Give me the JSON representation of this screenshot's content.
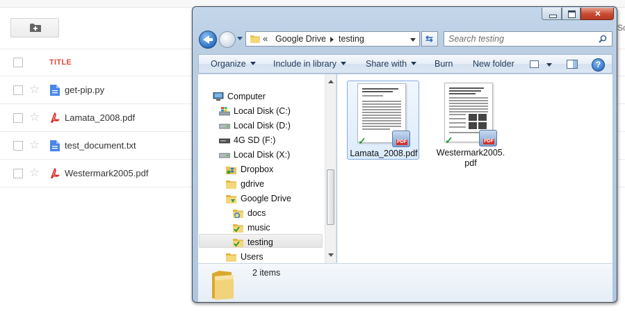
{
  "web": {
    "new_folder_label": "",
    "column_title": "TITLE",
    "files": [
      {
        "name": "get-pip.py",
        "icon": "document-icon",
        "color": "#4a86e8"
      },
      {
        "name": "Lamata_2008.pdf",
        "icon": "pdf-icon",
        "color": "#d93025"
      },
      {
        "name": "test_document.txt",
        "icon": "document-icon",
        "color": "#4a86e8"
      },
      {
        "name": "Westermark2005.pdf",
        "icon": "pdf-icon",
        "color": "#d93025"
      }
    ],
    "cut_text": "Sc"
  },
  "explorer": {
    "caption": {
      "minimize": "minimize",
      "maximize": "maximize",
      "close": "×"
    },
    "address": {
      "chevron": "«",
      "crumbs": [
        "Google Drive",
        "testing"
      ]
    },
    "search": {
      "placeholder": "Search testing"
    },
    "toolbar": {
      "organize": "Organize",
      "include": "Include in library",
      "share": "Share with",
      "burn": "Burn",
      "new_folder": "New folder",
      "help": "?"
    },
    "nav": [
      {
        "label": "Computer",
        "icon": "computer-icon"
      },
      {
        "label": "Local Disk (C:)",
        "icon": "windows-drive-icon"
      },
      {
        "label": "Local Disk (D:)",
        "icon": "drive-icon"
      },
      {
        "label": "4G SD (F:)",
        "icon": "sd-card-icon"
      },
      {
        "label": "Local Disk (X:)",
        "icon": "drive-icon"
      },
      {
        "label": "Dropbox",
        "icon": "dropbox-icon"
      },
      {
        "label": "gdrive",
        "icon": "folder-icon"
      },
      {
        "label": "Google Drive",
        "icon": "google-drive-folder-icon"
      },
      {
        "label": "docs",
        "icon": "sync-folder-icon"
      },
      {
        "label": "music",
        "icon": "synced-folder-icon"
      },
      {
        "label": "testing",
        "icon": "synced-folder-icon"
      },
      {
        "label": "Users",
        "icon": "folder-icon"
      }
    ],
    "files": [
      {
        "label": "Lamata_2008.pdf",
        "label_line2": "",
        "selected": true
      },
      {
        "label": "Westermark2005.",
        "label_line2": "pdf",
        "selected": false
      }
    ],
    "details": {
      "count": "2 items"
    }
  }
}
